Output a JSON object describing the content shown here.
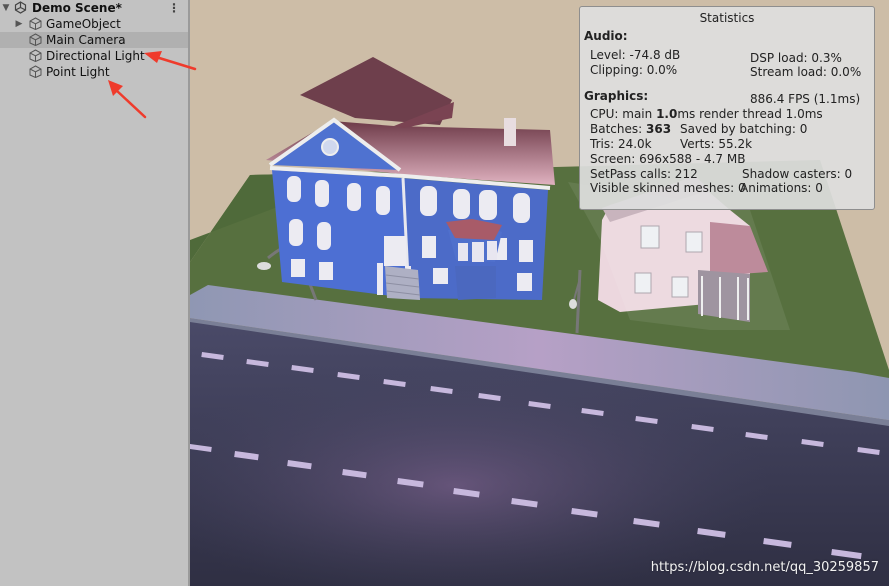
{
  "hierarchy": {
    "scene_name": "Demo Scene*",
    "items": [
      {
        "label": "GameObject"
      },
      {
        "label": "Main Camera"
      },
      {
        "label": "Directional Light"
      },
      {
        "label": "Point Light"
      }
    ],
    "menu_icon": "kebab-menu-icon",
    "annotation_color": "#ef3b2c"
  },
  "stats": {
    "title": "Statistics",
    "audio_header": "Audio:",
    "level": "Level: -74.8 dB",
    "dsp_load": "DSP load: 0.3%",
    "clipping": "Clipping: 0.0%",
    "stream_load": "Stream load: 0.0%",
    "graphics_header": "Graphics:",
    "fps": "886.4 FPS (1.1ms)",
    "cpu_prefix": "CPU: main ",
    "cpu_main": "1.0",
    "cpu_suffix": "ms  render thread 1.0ms",
    "batches_prefix": "Batches: ",
    "batches": "363",
    "saved": "Saved by batching: 0",
    "tris": "Tris: 24.0k",
    "verts": "Verts: 55.2k",
    "screen": "Screen: 696x588 - 4.7 MB",
    "setpass": "SetPass calls: 212",
    "shadow": "Shadow casters: 0",
    "skinned": "Visible skinned meshes: 0",
    "animations": "Animations: 0"
  },
  "watermark": "https://blog.csdn.net/qq_30259857"
}
